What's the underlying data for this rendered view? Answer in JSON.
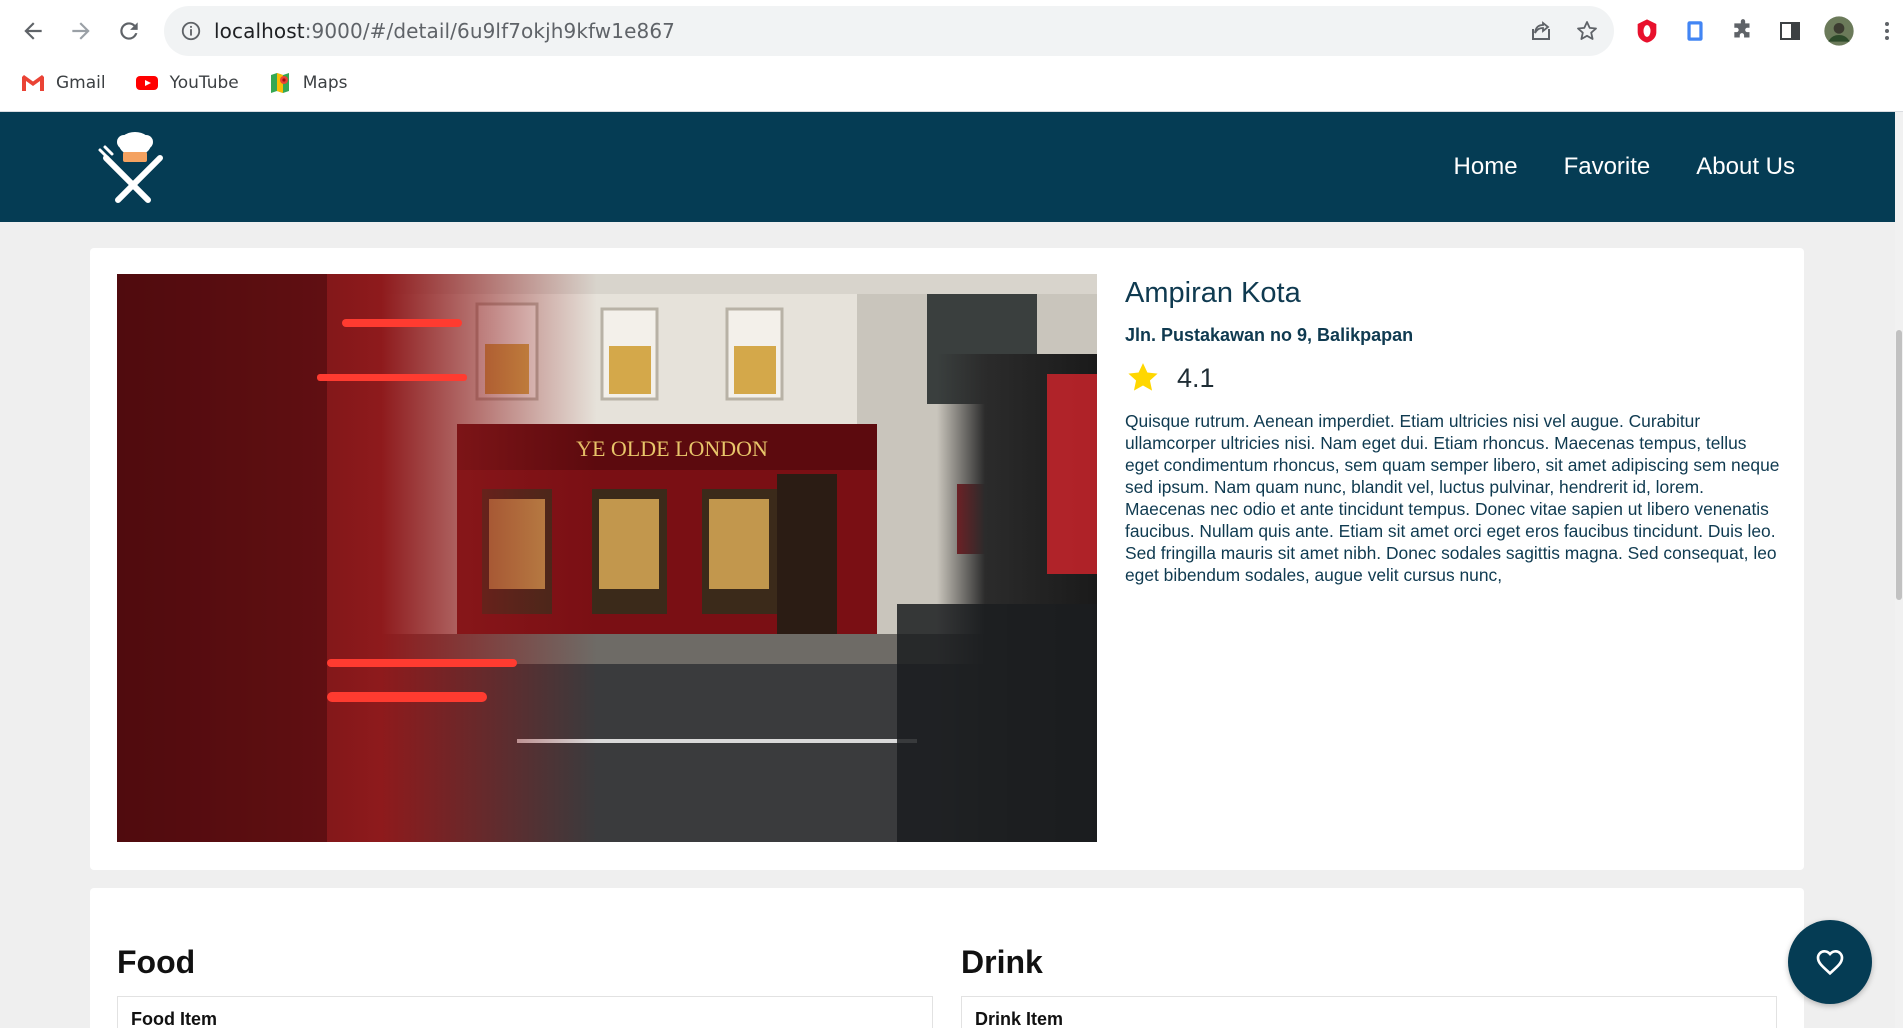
{
  "browser": {
    "url_host": "localhost",
    "url_path": ":9000/#/detail/6u9lf7okjh9kfw1e867",
    "bookmarks": [
      {
        "label": "Gmail",
        "icon": "gmail-icon"
      },
      {
        "label": "YouTube",
        "icon": "youtube-icon"
      },
      {
        "label": "Maps",
        "icon": "maps-icon"
      }
    ]
  },
  "navbar": {
    "logo_icon": "chef-hat-cutlery-logo",
    "links": [
      "Home",
      "Favorite",
      "About Us"
    ]
  },
  "restaurant": {
    "name": "Ampiran Kota",
    "address": "Jln. Pustakawan no 9, Balikpapan",
    "rating": "4.1",
    "description": "Quisque rutrum. Aenean imperdiet. Etiam ultricies nisi vel augue. Curabitur ullamcorper ultricies nisi. Nam eget dui. Etiam rhoncus. Maecenas tempus, tellus eget condimentum rhoncus, sem quam semper libero, sit amet adipiscing sem neque sed ipsum. Nam quam nunc, blandit vel, luctus pulvinar, hendrerit id, lorem. Maecenas nec odio et ante tincidunt tempus. Donec vitae sapien ut libero venenatis faucibus. Nullam quis ante. Etiam sit amet orci eget eros faucibus tincidunt. Duis leo. Sed fringilla mauris sit amet nibh. Donec sodales sagittis magna. Sed consequat, leo eget bibendum sodales, augue velit cursus nunc,",
    "photo_sign": "YE OLDE LONDON"
  },
  "menus": {
    "food": {
      "title": "Food",
      "column_header": "Food Item"
    },
    "drink": {
      "title": "Drink",
      "column_header": "Drink Item"
    }
  },
  "colors": {
    "primary": "#053c54",
    "star": "#ffd700",
    "text": "#0f3a50"
  }
}
